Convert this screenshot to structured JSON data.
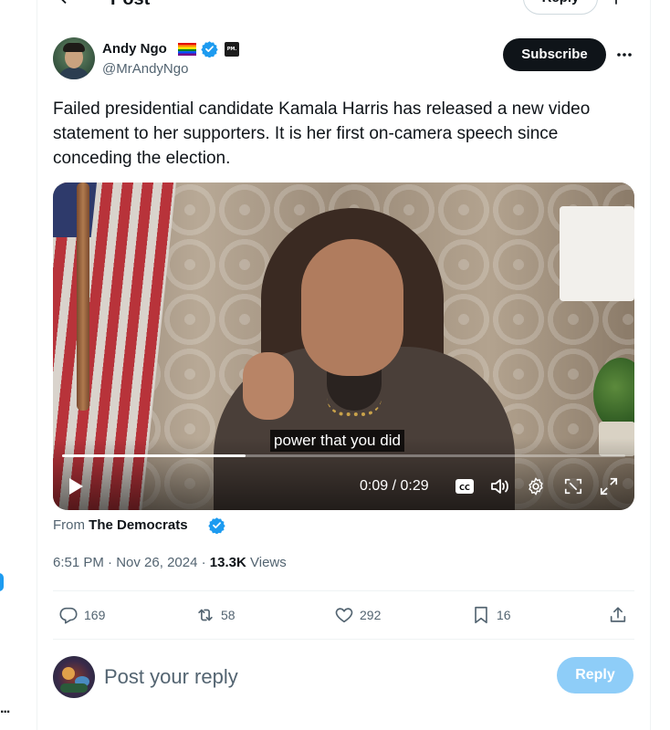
{
  "header": {
    "title": "Post",
    "reply_button": "Reply"
  },
  "author": {
    "name": "Andy Ngo",
    "handle": "@MrAndyNgo",
    "affiliate_badge": "PM.",
    "subscribe_label": "Subscribe"
  },
  "tweet": {
    "text": "Failed presidential candidate Kamala Harris has released a new video statement to her supporters. It is her first on-camera speech since conceding the election."
  },
  "video": {
    "caption": "power that you did",
    "time": "0:09 / 0:29",
    "progress": 0.326
  },
  "source": {
    "prefix": "From",
    "name": "The Democrats"
  },
  "meta": {
    "time": "6:51 PM",
    "separator": "·",
    "date": "Nov 26, 2024",
    "views_count": "13.3K",
    "views_label": "Views"
  },
  "actions": {
    "replies": "169",
    "reposts": "58",
    "likes": "292",
    "bookmarks": "16"
  },
  "composer": {
    "placeholder": "Post your reply",
    "reply_label": "Reply"
  },
  "colors": {
    "accent": "#1d9bf0",
    "text": "#0f1419",
    "secondary": "#536471",
    "reply_disabled": "#8ecdf8"
  },
  "left_edge": {
    "more": "..."
  }
}
